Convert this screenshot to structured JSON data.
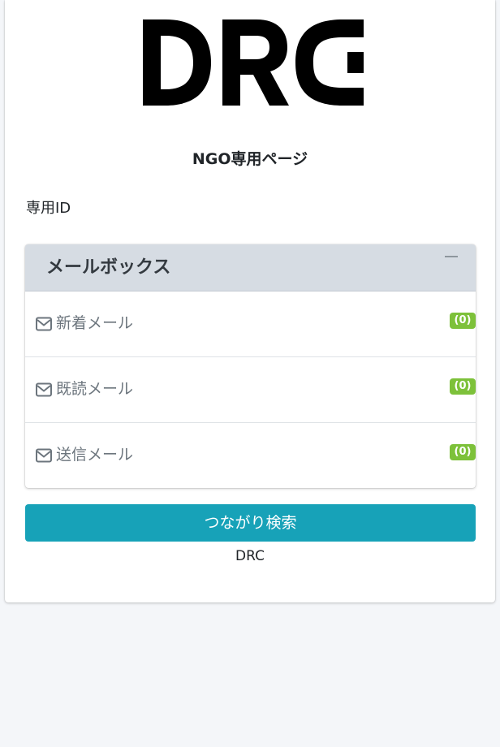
{
  "logo": {
    "text": "DRC",
    "color": "#000000"
  },
  "page_title": "NGO専用ページ",
  "id_label": "専用ID",
  "mailbox": {
    "title": "メールボックス",
    "collapse_icon": "minus-icon",
    "items": [
      {
        "label": "新着メール",
        "count": "(0)",
        "icon": "envelope-icon"
      },
      {
        "label": "既読メール",
        "count": "(0)",
        "icon": "envelope-icon"
      },
      {
        "label": "送信メール",
        "count": "(0)",
        "icon": "envelope-icon"
      }
    ]
  },
  "search_button": {
    "label": "つながり検索"
  },
  "footer": {
    "text": "DRC"
  },
  "colors": {
    "background": "#f4f6f9",
    "card": "#ffffff",
    "mailbox_header": "#d6dce3",
    "badge": "#7dc13a",
    "button": "#17a2b8"
  }
}
